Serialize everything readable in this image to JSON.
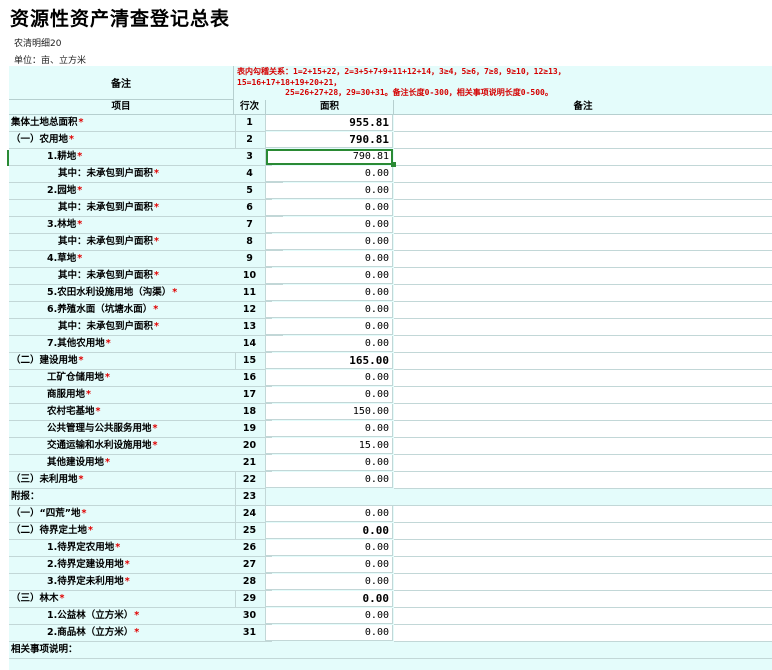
{
  "title": "资源性资产清查登记总表",
  "subtitle": "农清明细20",
  "unit": "单位：亩、立方米",
  "header": {
    "note_label": "备注",
    "note_lines": [
      "表内勾稽关系：1=2+15+22，2=3+5+7+9+11+12+14，3≥4，5≥6，7≥8，9≥10，12≥13，",
      "15=16+17+18+19+20+21，",
      "          25=26+27+28，29=30+31。备注长度0-300，相关事项说明长度0-500。"
    ],
    "col_item": "项目",
    "col_line": "行次",
    "col_area": "面积",
    "col_remark": "备注"
  },
  "rows": [
    {
      "name": "集体土地总面积",
      "line": "1",
      "area": "955.81",
      "indent": 0,
      "req": true,
      "bold": true
    },
    {
      "name": "（一）农用地",
      "line": "2",
      "area": "790.81",
      "indent": 0,
      "req": true,
      "bold": true
    },
    {
      "name": "1.耕地",
      "line": "3",
      "area": "790.81",
      "indent": 1,
      "req": true,
      "bold": false,
      "selected": true
    },
    {
      "name": "其中：未承包到户面积",
      "line": "4",
      "area": "0.00",
      "indent": 2,
      "req": true
    },
    {
      "name": "2.园地",
      "line": "5",
      "area": "0.00",
      "indent": 1,
      "req": true
    },
    {
      "name": "其中：未承包到户面积",
      "line": "6",
      "area": "0.00",
      "indent": 2,
      "req": true
    },
    {
      "name": "3.林地",
      "line": "7",
      "area": "0.00",
      "indent": 1,
      "req": true
    },
    {
      "name": "其中：未承包到户面积",
      "line": "8",
      "area": "0.00",
      "indent": 2,
      "req": true
    },
    {
      "name": "4.草地",
      "line": "9",
      "area": "0.00",
      "indent": 1,
      "req": true
    },
    {
      "name": "其中：未承包到户面积",
      "line": "10",
      "area": "0.00",
      "indent": 2,
      "req": true
    },
    {
      "name": "5.农田水利设施用地（沟渠）",
      "line": "11",
      "area": "0.00",
      "indent": 1,
      "req": true
    },
    {
      "name": "6.养殖水面（坑塘水面）",
      "line": "12",
      "area": "0.00",
      "indent": 1,
      "req": true
    },
    {
      "name": "其中：未承包到户面积",
      "line": "13",
      "area": "0.00",
      "indent": 2,
      "req": true
    },
    {
      "name": "7.其他农用地",
      "line": "14",
      "area": "0.00",
      "indent": 1,
      "req": true
    },
    {
      "name": "（二）建设用地",
      "line": "15",
      "area": "165.00",
      "indent": 0,
      "req": true,
      "bold": true
    },
    {
      "name": "工矿仓储用地",
      "line": "16",
      "area": "0.00",
      "indent": 1,
      "req": true
    },
    {
      "name": "商服用地",
      "line": "17",
      "area": "0.00",
      "indent": 1,
      "req": true
    },
    {
      "name": "农村宅基地",
      "line": "18",
      "area": "150.00",
      "indent": 1,
      "req": true
    },
    {
      "name": "公共管理与公共服务用地",
      "line": "19",
      "area": "0.00",
      "indent": 1,
      "req": true
    },
    {
      "name": "交通运输和水利设施用地",
      "line": "20",
      "area": "15.00",
      "indent": 1,
      "req": true
    },
    {
      "name": "其他建设用地",
      "line": "21",
      "area": "0.00",
      "indent": 1,
      "req": true
    },
    {
      "name": "（三）未利用地",
      "line": "22",
      "area": "0.00",
      "indent": 0,
      "req": true
    },
    {
      "name": "附报：",
      "line": "23",
      "area": "",
      "indent": 0,
      "req": false,
      "noinput": true
    },
    {
      "name": "（一）“四荒”地",
      "line": "24",
      "area": "0.00",
      "indent": 0,
      "req": true
    },
    {
      "name": "（二）待界定土地",
      "line": "25",
      "area": "0.00",
      "indent": 0,
      "req": true,
      "bold": true
    },
    {
      "name": "1.待界定农用地",
      "line": "26",
      "area": "0.00",
      "indent": 1,
      "req": true
    },
    {
      "name": "2.待界定建设用地",
      "line": "27",
      "area": "0.00",
      "indent": 1,
      "req": true
    },
    {
      "name": "3.待界定未利用地",
      "line": "28",
      "area": "0.00",
      "indent": 1,
      "req": true
    },
    {
      "name": "（三）林木",
      "line": "29",
      "area": "0.00",
      "indent": 0,
      "req": true,
      "bold": true
    },
    {
      "name": "1.公益林（立方米）",
      "line": "30",
      "area": "0.00",
      "indent": 1,
      "req": true
    },
    {
      "name": "2.商品林（立方米）",
      "line": "31",
      "area": "0.00",
      "indent": 1,
      "req": true
    }
  ],
  "footer_label": "相关事项说明：",
  "req_mark": "*",
  "colors": {
    "required": "#e00000",
    "sheet_bg": "#e4fcfb",
    "note_red": "#d40000",
    "selection": "#2a8a34"
  }
}
